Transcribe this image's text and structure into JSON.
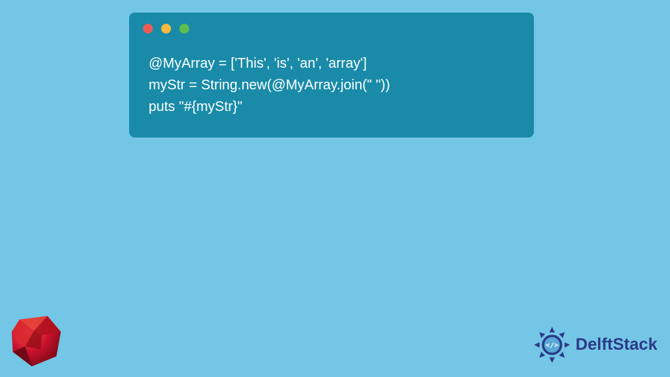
{
  "code": {
    "line1": "@MyArray = ['This', 'is', 'an', 'array']",
    "line2": "myStr = String.new(@MyArray.join(\" \"))",
    "line3": "puts \"#{myStr}\""
  },
  "brand": {
    "name": "DelftStack"
  },
  "colors": {
    "page_bg": "#74c6e6",
    "window_bg": "#198ba8",
    "traffic_red": "#ec5c55",
    "traffic_yellow": "#f4b93e",
    "traffic_green": "#5ebd4b",
    "brand_text": "#2c3a88"
  }
}
